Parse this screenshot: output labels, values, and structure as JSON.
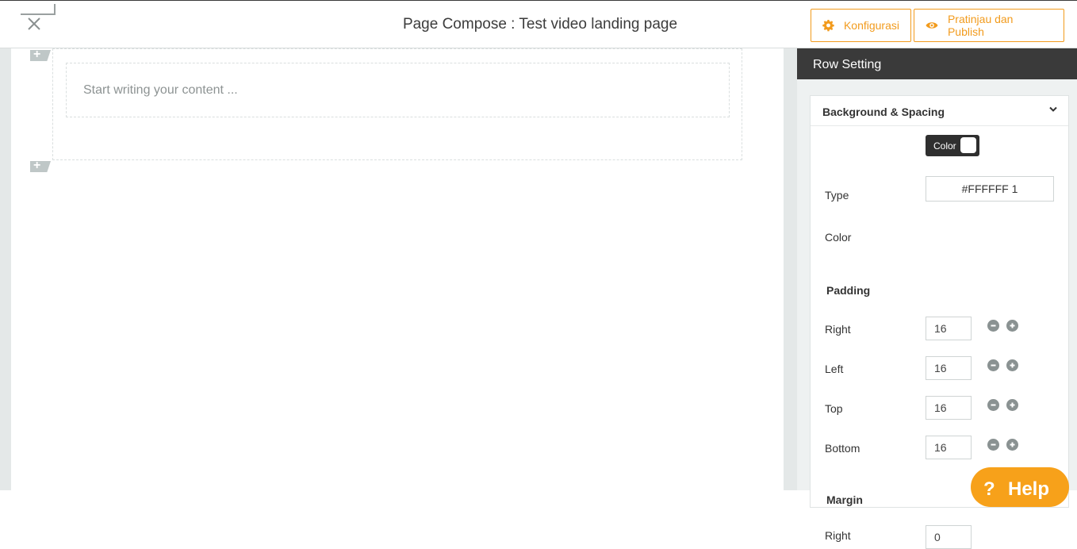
{
  "header": {
    "title": "Page Compose : Test video landing page",
    "config_label": "Konfigurasi",
    "publish_label": "Pratinjau dan Publish"
  },
  "editor": {
    "placeholder": "Start writing your content ...",
    "add_icon": "+"
  },
  "panel": {
    "title": "Row Setting",
    "section_title": "Background & Spacing",
    "type_label": "Type",
    "type_value": "Color",
    "color_label": "Color",
    "color_value": "#FFFFFF 1",
    "padding_title": "Padding",
    "padding": [
      {
        "label": "Right",
        "value": "16"
      },
      {
        "label": "Left",
        "value": "16"
      },
      {
        "label": "Top",
        "value": "16"
      },
      {
        "label": "Bottom",
        "value": "16"
      }
    ],
    "margin_title": "Margin",
    "margin": [
      {
        "label": "Right",
        "value": "0"
      }
    ]
  },
  "help": {
    "icon": "?",
    "label": "Help"
  },
  "colors": {
    "accent": "#f29b1d",
    "help": "#f7a11a",
    "dark": "#3a3a3a",
    "muted_icon": "#8a9292"
  },
  "icons": [
    "close-icon",
    "gear-icon",
    "eye-icon",
    "plus-icon",
    "chevron-down-icon",
    "minus-circle-icon",
    "plus-circle-icon",
    "help-icon"
  ]
}
